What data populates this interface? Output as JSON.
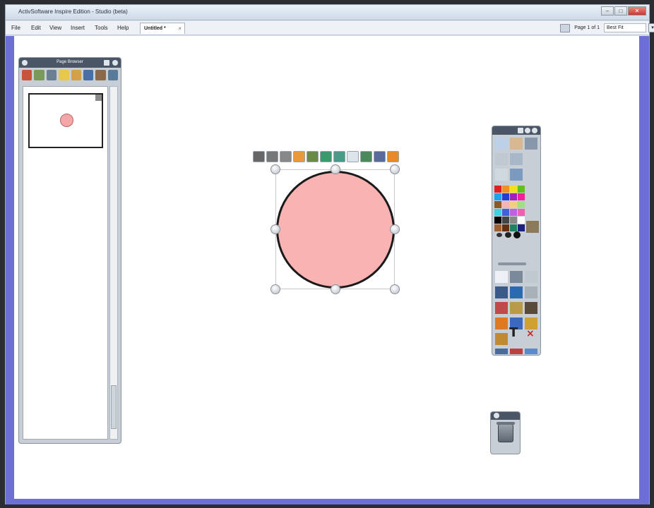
{
  "window": {
    "title": "ActivSoftware Inspire Edition - Studio (beta)",
    "controls": [
      "–",
      "□",
      "✕"
    ]
  },
  "menubar": {
    "items": [
      "File",
      "Edit",
      "View",
      "Insert",
      "Tools",
      "Help"
    ],
    "document_tab": "Untitled *",
    "document_tab_close": "×",
    "page_indicator": "Page 1 of 1",
    "zoom_value": "Best Fit",
    "zoom_arrow": "▾"
  },
  "page_browser": {
    "title": "Page Browser",
    "tool_colors": [
      "#c8553b",
      "#7a9a5a",
      "#6b7f93",
      "#e8c84a",
      "#d4a04a",
      "#4a6fa5",
      "#8a6a4a",
      "#5a7a9a"
    ]
  },
  "canvas": {
    "circle_fill": "#f9b3b3",
    "circle_stroke": "#1a1a1a",
    "shape_toolbar_colors": [
      "#666",
      "#777",
      "#888",
      "#e89a3a",
      "#6a8a4a",
      "#3a9a6a",
      "#4a9a8a",
      "#dde4ec",
      "#4a8a5a",
      "#5a6a9a",
      "#e88a2a"
    ]
  },
  "toolbox": {
    "text_tool": "T",
    "delete_tool": "×",
    "palette": [
      "#e02020",
      "#f09020",
      "#f0e020",
      "#60c020",
      "#20a0f0",
      "#2040d0",
      "#a020c0",
      "#f020a0",
      "#8a5a2a",
      "#f7b3b3",
      "#f0d080",
      "#a0e080",
      "#40d0e0",
      "#4060e0",
      "#c060e0",
      "#f060b0",
      "#000000",
      "#444444",
      "#888888",
      "#ffffff",
      "#a06030",
      "#603010",
      "#208060",
      "#202080"
    ]
  }
}
